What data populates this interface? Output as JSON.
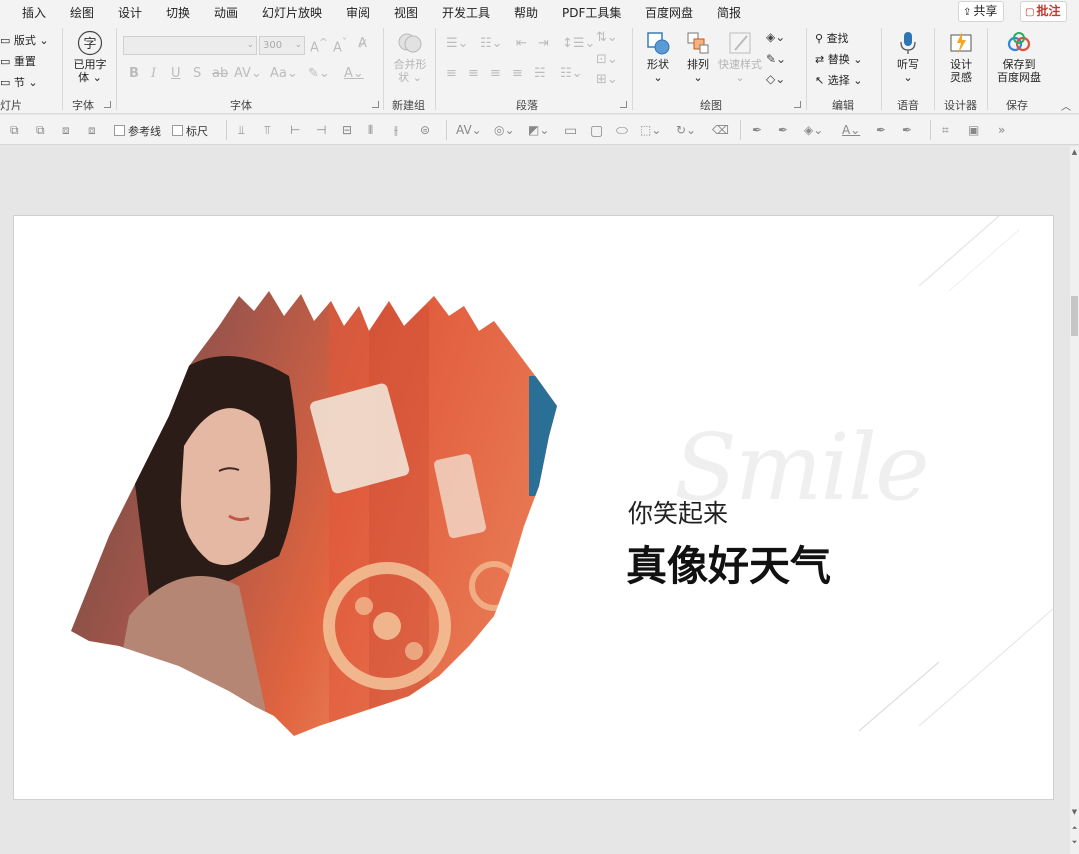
{
  "tabs": [
    "插入",
    "绘图",
    "设计",
    "切换",
    "动画",
    "幻灯片放映",
    "审阅",
    "视图",
    "开发工具",
    "帮助",
    "PDF工具集",
    "百度网盘",
    "简报"
  ],
  "share_button": "共享",
  "comment_button": "批注",
  "ribbon": {
    "slides": {
      "layout": "版式",
      "reset": "重置",
      "section": "节",
      "group": "灯片"
    },
    "used_fonts": {
      "label_line1": "已用字",
      "label_line2": "体",
      "group": "字体"
    },
    "font": {
      "size": "300",
      "group": "字体"
    },
    "newgroup": {
      "merge_line1": "合并形",
      "merge_line2": "状",
      "group": "新建组"
    },
    "paragraph": {
      "group": "段落"
    },
    "drawing": {
      "shapes": "形状",
      "arrange": "排列",
      "quick_styles": "快速样式",
      "group": "绘图"
    },
    "editing": {
      "find": "查找",
      "replace": "替换",
      "select": "选择",
      "group": "编辑"
    },
    "voice": {
      "dictate": "听写",
      "group": "语音"
    },
    "designer": {
      "ideas_line1": "设计",
      "ideas_line2": "灵感",
      "group": "设计器"
    },
    "save": {
      "save_line1": "保存到",
      "save_line2": "百度网盘",
      "group": "保存"
    }
  },
  "toolbar2": {
    "guides_label": "参考线",
    "ruler_label": "标尺",
    "more": "»"
  },
  "slide": {
    "watermark": "Smile",
    "subtitle": "你笑起来",
    "title": "真像好天气"
  },
  "colors": {
    "accent": "#c0392b",
    "ribbon_bg": "#f3f3f3",
    "canvas_bg": "#e6e6e6"
  }
}
